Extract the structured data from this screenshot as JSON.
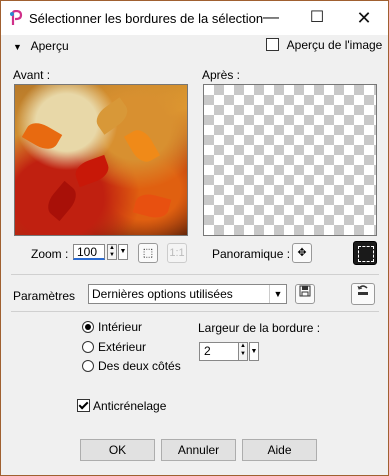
{
  "window": {
    "title": "Sélectionner les bordures de la sélection"
  },
  "apercu": {
    "label": "Aperçu",
    "image_label": "Aperçu de l'image",
    "image_checked": false
  },
  "preview": {
    "before_label": "Avant :",
    "after_label": "Après :"
  },
  "zoom": {
    "label": "Zoom :",
    "value": "100"
  },
  "pan": {
    "label": "Panoramique :"
  },
  "params": {
    "label": "Paramètres",
    "selected": "Dernières options utilisées"
  },
  "options": {
    "interior": "Intérieur",
    "exterior": "Extérieur",
    "both": "Des deux côtés",
    "selected": "interior"
  },
  "border_width": {
    "label": "Largeur de la bordure :",
    "value": "2"
  },
  "antialias": {
    "label": "Anticrénelage",
    "checked": true
  },
  "buttons": {
    "ok": "OK",
    "cancel": "Annuler",
    "help": "Aide"
  },
  "icons": {
    "app": "paintshop-icon",
    "minimize": "minimize-icon",
    "maximize": "maximize-icon",
    "close": "close-icon",
    "zoom_fit": "zoom-fit-icon",
    "zoom_actual": "zoom-actual-size-icon",
    "pan": "pan-move-icon",
    "selection": "selection-marquee-icon",
    "save_preset": "save-icon",
    "reset": "reset-preset-icon"
  }
}
